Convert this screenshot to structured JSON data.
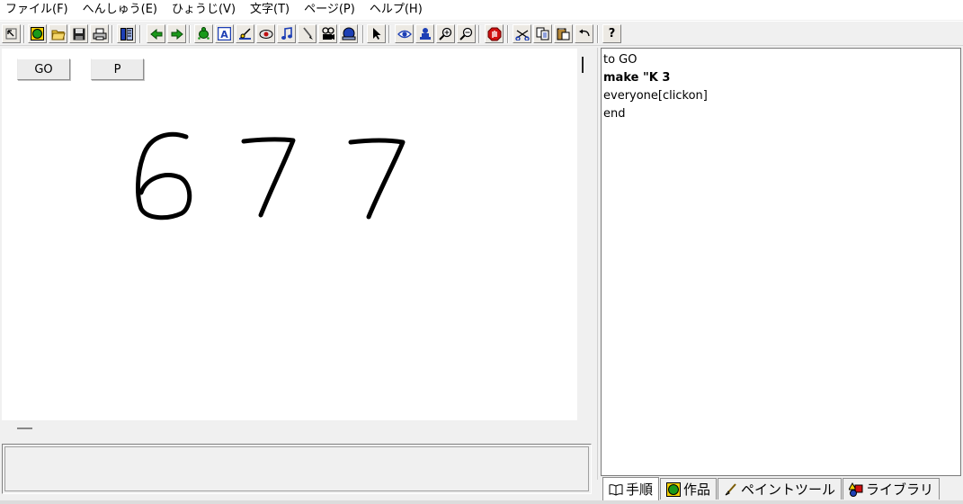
{
  "menubar": {
    "items": [
      {
        "label": "ファイル(F)"
      },
      {
        "label": "へんしゅう(E)"
      },
      {
        "label": "ひょうじ(V)"
      },
      {
        "label": "文字(T)"
      },
      {
        "label": "ページ(P)"
      },
      {
        "label": "ヘルプ(H)"
      }
    ]
  },
  "toolbar": {
    "icons": [
      "select-arrow-icon",
      "globe-icon",
      "open-folder-icon",
      "save-disk-icon",
      "print-icon",
      "layout-icon",
      "left-arrow-icon",
      "right-arrow-icon",
      "turtle-icon",
      "text-box-icon",
      "slider-icon",
      "bitmap-icon",
      "music-note-icon",
      "brush-icon",
      "video-icon",
      "stamp-icon",
      "pointer-icon",
      "eye-icon",
      "stamp-person-icon",
      "zoom-in-icon",
      "zoom-out-icon",
      "stop-hand-icon",
      "cut-icon",
      "copy-icon",
      "paste-icon",
      "undo-icon",
      "help-icon"
    ],
    "help_label": "?",
    "text_box_label": "A"
  },
  "canvas": {
    "buttons": [
      {
        "label": "GO"
      },
      {
        "label": "P"
      }
    ],
    "display_text": "677"
  },
  "editor": {
    "lines": [
      {
        "text": "to GO",
        "bold": false
      },
      {
        "text": "make \"K 3",
        "bold": true
      },
      {
        "text": "everyone[clickon]",
        "bold": false
      },
      {
        "text": "end",
        "bold": false
      }
    ]
  },
  "tabs": [
    {
      "label": "手順",
      "icon": "book-icon"
    },
    {
      "label": "作品",
      "icon": "globe-icon"
    },
    {
      "label": "ペイントツール",
      "icon": "paintbrush-icon"
    },
    {
      "label": "ライブラリ",
      "icon": "shapes-icon"
    }
  ],
  "colors": {
    "toolbar_green": "#1a9a1a",
    "toolbar_blue": "#1d3fb5",
    "stop_red": "#d01010",
    "ink": "#000000"
  }
}
